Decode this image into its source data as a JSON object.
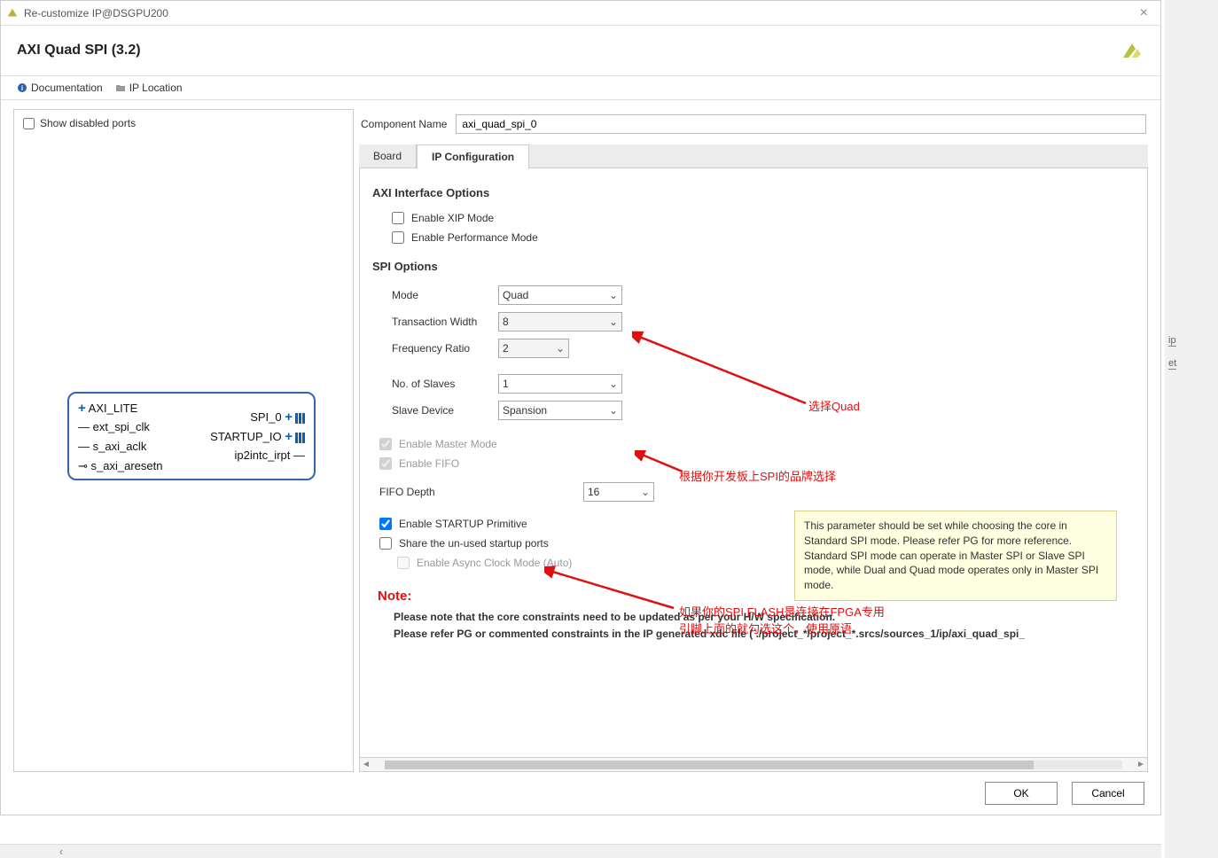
{
  "window": {
    "title": "Re-customize IP@DSGPU200"
  },
  "header": {
    "title": "AXI Quad SPI (3.2)"
  },
  "toolbar": {
    "documentation": "Documentation",
    "ip_location": "IP Location"
  },
  "leftpane": {
    "show_disabled": "Show disabled ports",
    "ports_left": [
      "AXI_LITE",
      "ext_spi_clk",
      "s_axi_aclk",
      "s_axi_aresetn"
    ],
    "ports_right": [
      "SPI_0",
      "STARTUP_IO",
      "ip2intc_irpt"
    ]
  },
  "component": {
    "label": "Component Name",
    "value": "axi_quad_spi_0"
  },
  "tabs": {
    "board": "Board",
    "ipconfig": "IP Configuration"
  },
  "axi_section": {
    "title": "AXI Interface Options",
    "enable_xip": "Enable XIP Mode",
    "enable_perf": "Enable Performance Mode"
  },
  "spi_section": {
    "title": "SPI Options",
    "mode_label": "Mode",
    "mode_value": "Quad",
    "tw_label": "Transaction Width",
    "tw_value": "8",
    "fr_label": "Frequency Ratio",
    "fr_value": "2",
    "ns_label": "No. of Slaves",
    "ns_value": "1",
    "sd_label": "Slave Device",
    "sd_value": "Spansion",
    "enable_master": "Enable Master Mode",
    "enable_fifo": "Enable FIFO",
    "fifo_depth_label": "FIFO Depth",
    "fifo_depth_value": "16",
    "enable_startup": "Enable STARTUP Primitive",
    "share_unused": "Share the un-used startup ports",
    "enable_async": "Enable Async Clock Mode (Auto)"
  },
  "note": {
    "head": "Note:",
    "line1": "Please note that the core constraints need to be updated as per your H/W specification.",
    "line2": "Please refer PG or commented constraints in the IP generated xdc file ( ./project_*/project_*.srcs/sources_1/ip/axi_quad_spi_"
  },
  "tooltip": "This parameter should be set while choosing the core in Standard SPI mode. Please refer PG for more reference. Standard SPI mode can operate in Master SPI or Slave SPI mode, while Dual and Quad mode operates only in Master SPI mode.",
  "annotations": {
    "a1": "选择Quad",
    "a2": "根据你开发板上SPI的品牌选择",
    "a3_l1": "如果你的SPI FLASH是连接在FPGA专用",
    "a3_l2": "引脚上面的就勾选这个，使用原语"
  },
  "footer": {
    "ok": "OK",
    "cancel": "Cancel"
  }
}
